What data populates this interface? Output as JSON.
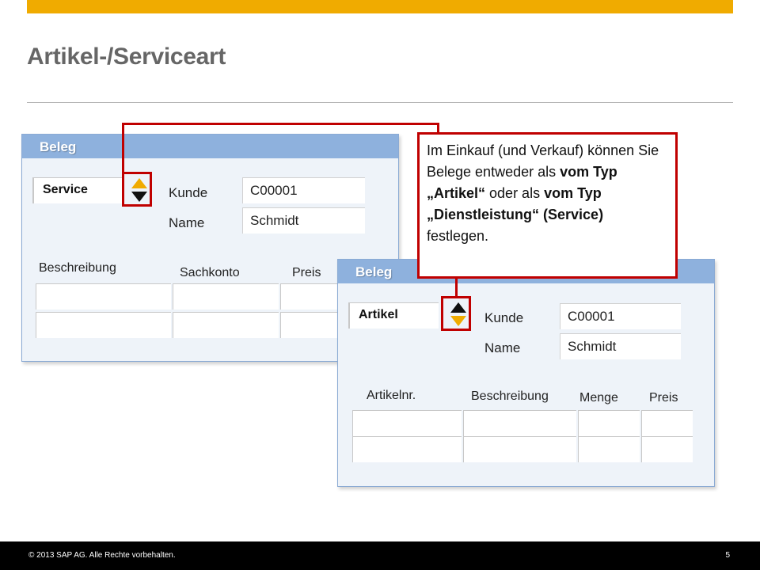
{
  "slide": {
    "title": "Artikel-/Serviceart",
    "footer_copyright": "© 2013 SAP AG. Alle Rechte vorbehalten.",
    "page_number": "5"
  },
  "colors": {
    "accent": "#f0ab00",
    "highlight": "#c00000",
    "panel_header": "#8eb1dd",
    "panel_body": "#eef3f9"
  },
  "panel_service": {
    "header": "Beleg",
    "type_value": "Service",
    "kunde_label": "Kunde",
    "kunde_value": "C00001",
    "name_label": "Name",
    "name_value": "Schmidt",
    "columns": [
      "Beschreibung",
      "Sachkonto",
      "Preis"
    ]
  },
  "panel_artikel": {
    "header": "Beleg",
    "type_value": "Artikel",
    "kunde_label": "Kunde",
    "kunde_value": "C00001",
    "name_label": "Name",
    "name_value": "Schmidt",
    "columns": [
      "Artikelnr.",
      "Beschreibung",
      "Menge",
      "Preis"
    ]
  },
  "callout": {
    "part1": "Im Einkauf (und Verkauf) können Sie Belege entweder als ",
    "bold1": "vom Typ „Artikel“",
    "part2": " oder als ",
    "bold2": "vom Typ „Dienstleistung“ (Service)",
    "part3": " festlegen."
  },
  "icons": {
    "spinner": "up-down-spinner-icon"
  }
}
